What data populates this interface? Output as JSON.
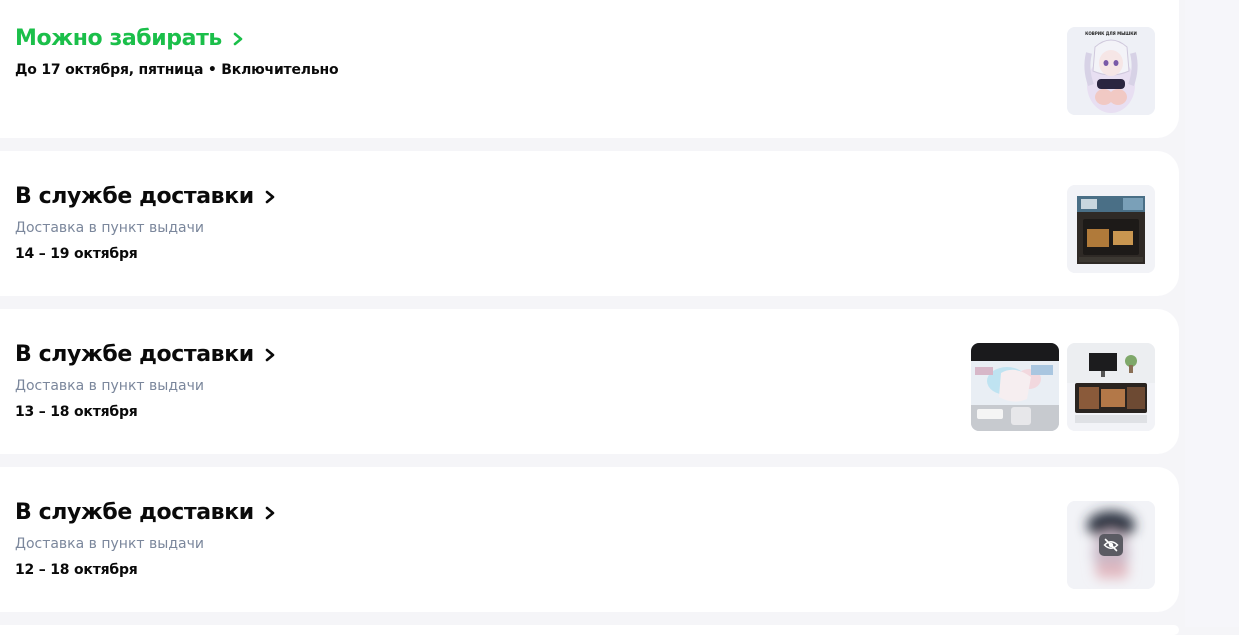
{
  "orders": [
    {
      "status": "Можно забирать",
      "status_color": "#1bbf4a",
      "subtitle": "",
      "date": "До 17 октября, пятница • Включительно",
      "items": [
        {
          "kind": "anime-mousepad",
          "caption": "КОВРИК ДЛЯ МЫШКИ"
        }
      ]
    },
    {
      "status": "В службе доставки",
      "subtitle": "Доставка в пункт выдачи",
      "date": "14 – 19 октября",
      "items": [
        {
          "kind": "desk-mousepad"
        }
      ]
    },
    {
      "status": "В службе доставки",
      "subtitle": "Доставка в пункт выдачи",
      "date": "13 – 18 октября",
      "items": [
        {
          "kind": "anime-desk-photo"
        },
        {
          "kind": "desk-setup"
        }
      ]
    },
    {
      "status": "В службе доставки",
      "subtitle": "Доставка в пункт выдачи",
      "date": "12 – 18 октября",
      "items": [
        {
          "kind": "hidden-content",
          "icon": "eye-off-icon"
        }
      ]
    }
  ]
}
